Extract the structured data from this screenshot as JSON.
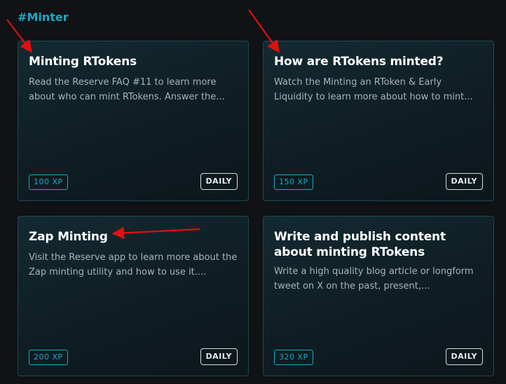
{
  "section": {
    "title": "#Minter"
  },
  "cards": [
    {
      "title": "Minting RTokens",
      "description": "Read the Reserve FAQ #11 to learn more about who can mint RTokens. Answer the...",
      "xp": "100 XP",
      "frequency": "DAILY"
    },
    {
      "title": "How are RTokens minted?",
      "description": "Watch the Minting an RToken & Early Liquidity to learn more about how to mint...",
      "xp": "150 XP",
      "frequency": "DAILY"
    },
    {
      "title": "Zap Minting",
      "description": "Visit the Reserve app to learn more about the Zap minting utility and how to use it....",
      "xp": "200 XP",
      "frequency": "DAILY"
    },
    {
      "title": "Write and publish content about minting RTokens",
      "description": "Write a high quality blog article or longform tweet on X on the past, present,...",
      "xp": "320 XP",
      "frequency": "DAILY"
    }
  ],
  "colors": {
    "accent": "#1aa9c4",
    "annotation_arrow": "#e01010",
    "background": "#101215"
  }
}
